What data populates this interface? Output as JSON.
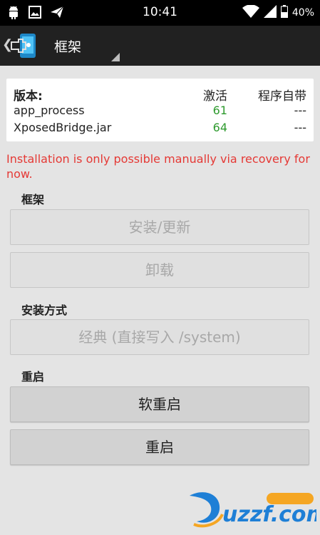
{
  "status_bar": {
    "time": "10:41",
    "battery": "40%",
    "icons": [
      "android-icon",
      "image-icon",
      "send-icon",
      "wifi-icon",
      "signal-icon",
      "battery-icon"
    ]
  },
  "action_bar": {
    "title": "框架"
  },
  "versions": {
    "header": {
      "label": "版本:",
      "active": "激活",
      "bundled": "程序自带"
    },
    "rows": [
      {
        "name": "app_process",
        "active": "61",
        "bundled": "---"
      },
      {
        "name": "XposedBridge.jar",
        "active": "64",
        "bundled": "---"
      }
    ]
  },
  "warning": "Installation is only possible manually via recovery for now.",
  "framework": {
    "title": "框架",
    "install_label": "安装/更新",
    "uninstall_label": "卸载"
  },
  "install_mode": {
    "title": "安装方式",
    "mode_label": "经典 (直接写入 /system)"
  },
  "reboot": {
    "title": "重启",
    "soft_reboot_label": "软重启",
    "reboot_label": "重启"
  },
  "colors": {
    "warning": "#e53935",
    "active_version": "#2e9a2e",
    "action_bar": "#212121",
    "background": "#e4e4e4"
  }
}
